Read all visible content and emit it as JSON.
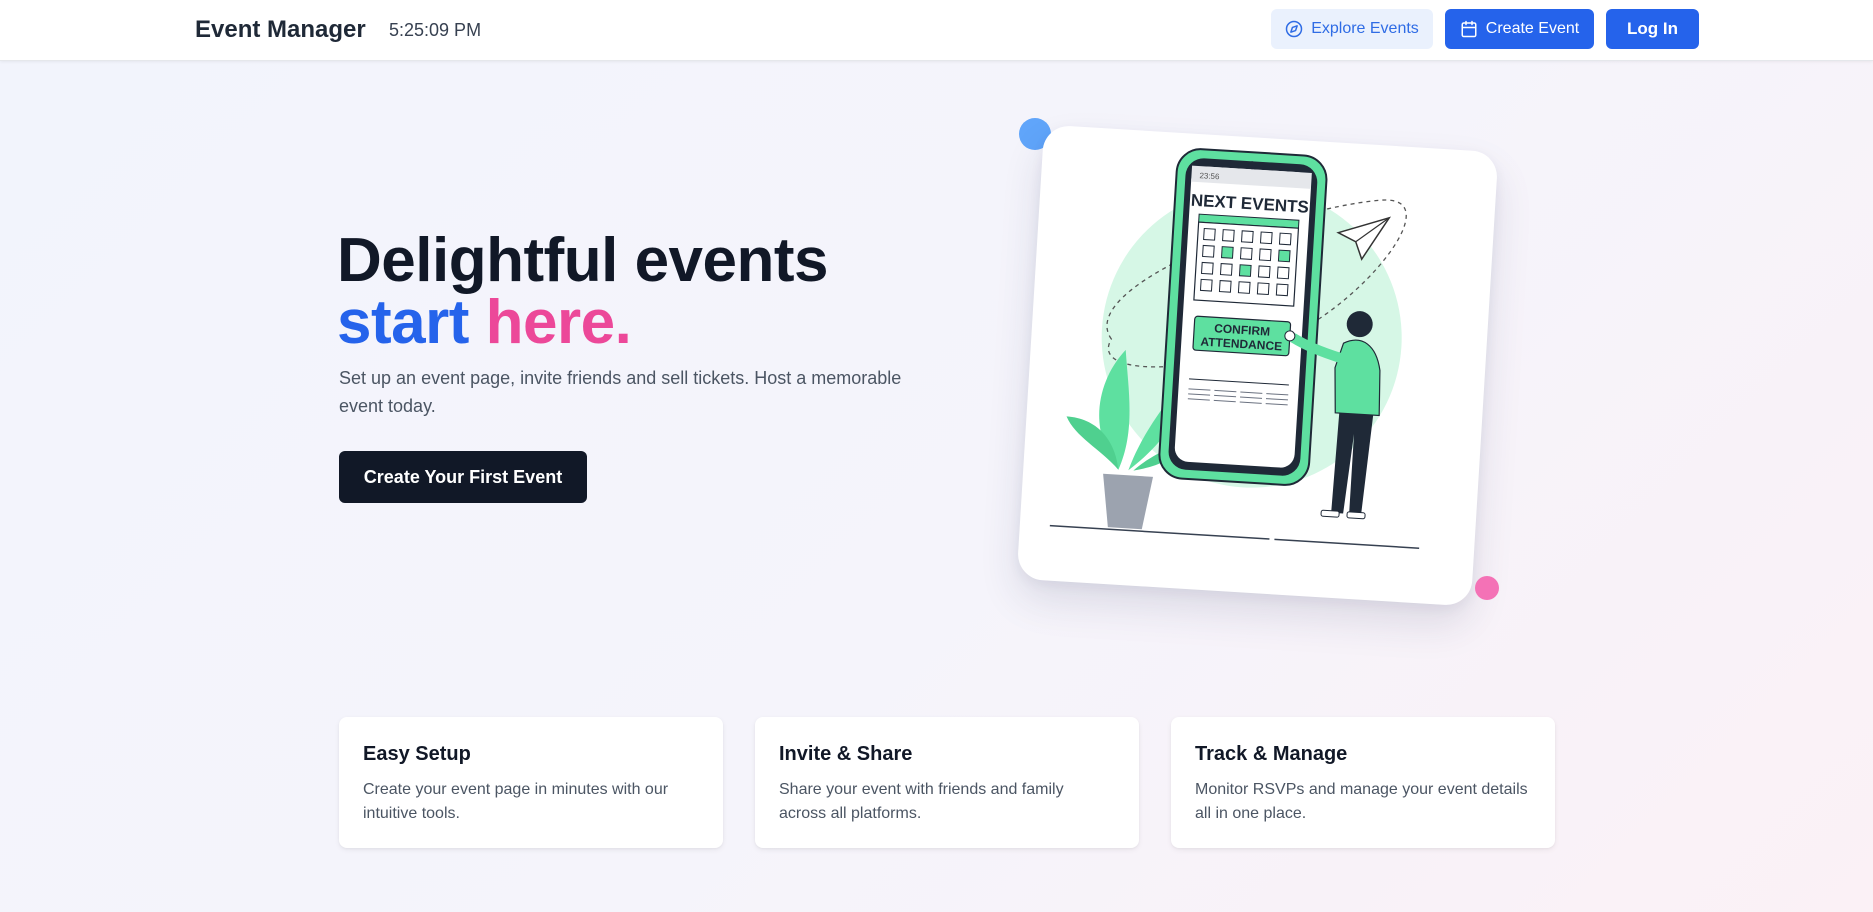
{
  "header": {
    "brand": "Event Manager",
    "time": "5:25:09 PM",
    "explore_label": "Explore Events",
    "create_label": "Create Event",
    "login_label": "Log In"
  },
  "hero": {
    "title_line1": "Delightful events",
    "title_word_blue": "start",
    "title_word_pink": "here.",
    "subtitle": "Set up an event page, invite friends and sell tickets. Host a memorable event today.",
    "cta_label": "Create Your First Event"
  },
  "illustration": {
    "phone_time": "23:56",
    "phone_heading": "NEXT EVENTS",
    "confirm_line1": "CONFIRM",
    "confirm_line2": "ATTENDANCE"
  },
  "features": [
    {
      "title": "Easy Setup",
      "text": "Create your event page in minutes with our intuitive tools."
    },
    {
      "title": "Invite & Share",
      "text": "Share your event with friends and family across all platforms."
    },
    {
      "title": "Track & Manage",
      "text": "Monitor RSVPs and manage your event details all in one place."
    }
  ],
  "colors": {
    "primary": "#2563eb",
    "accent_pink": "#ec4899",
    "dark": "#111827",
    "illustration_green": "#5ee0a0",
    "dot_blue": "#60a5fa",
    "dot_pink": "#f472b6"
  },
  "icons": {
    "explore": "compass-icon",
    "create": "calendar-icon"
  }
}
